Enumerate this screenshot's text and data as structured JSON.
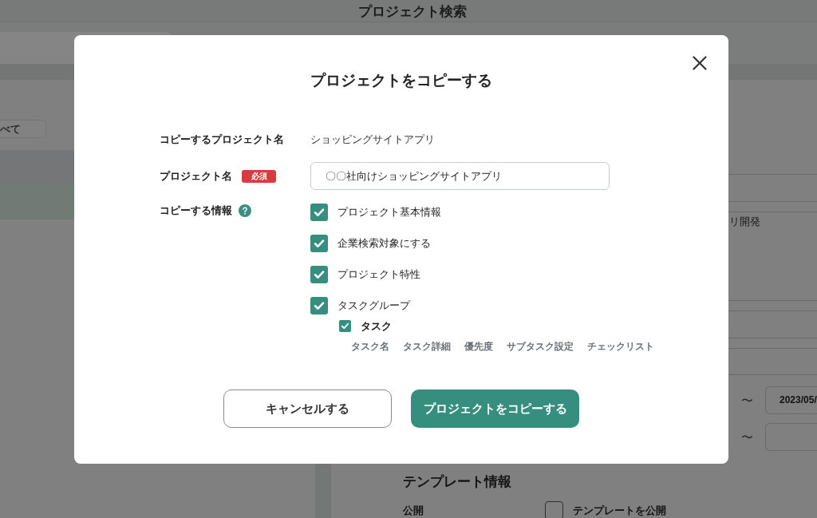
{
  "background_page": {
    "title": "プロジェクト検索",
    "filter_button": {
      "label": "べて"
    },
    "description_fragment": "リ開発",
    "date_range": [
      {
        "separator": "〜",
        "value": "2023/05/"
      },
      {
        "separator": "〜"
      }
    ],
    "template_section": {
      "heading": "テンプレート情報",
      "label": "公開",
      "checkbox": {
        "label": "テンプレートを公開",
        "checked": false
      }
    }
  },
  "dialog": {
    "title": "プロジェクトをコピーする",
    "source_project": {
      "label": "コピーするプロジェクト名",
      "value": "ショッピングサイトアプリ"
    },
    "project_name": {
      "label": "プロジェクト名",
      "badge": "必須",
      "value": "〇〇社向けショッピングサイトアプリ"
    },
    "copy_info": {
      "label": "コピーする情報",
      "options": [
        {
          "label": "プロジェクト基本情報",
          "checked": true
        },
        {
          "label": "企業検索対象にする",
          "checked": true
        },
        {
          "label": "プロジェクト特性",
          "checked": true
        },
        {
          "label": "タスクグループ",
          "checked": true,
          "children": [
            {
              "label": "タスク",
              "checked": true,
              "items": [
                "タスク名",
                "タスク詳細",
                "優先度",
                "サブタスク設定",
                "チェックリスト"
              ]
            }
          ]
        }
      ]
    },
    "buttons": [
      {
        "label": "キャンセルする",
        "kind": "secondary"
      },
      {
        "label": "プロジェクトをコピーする",
        "kind": "primary"
      }
    ]
  }
}
